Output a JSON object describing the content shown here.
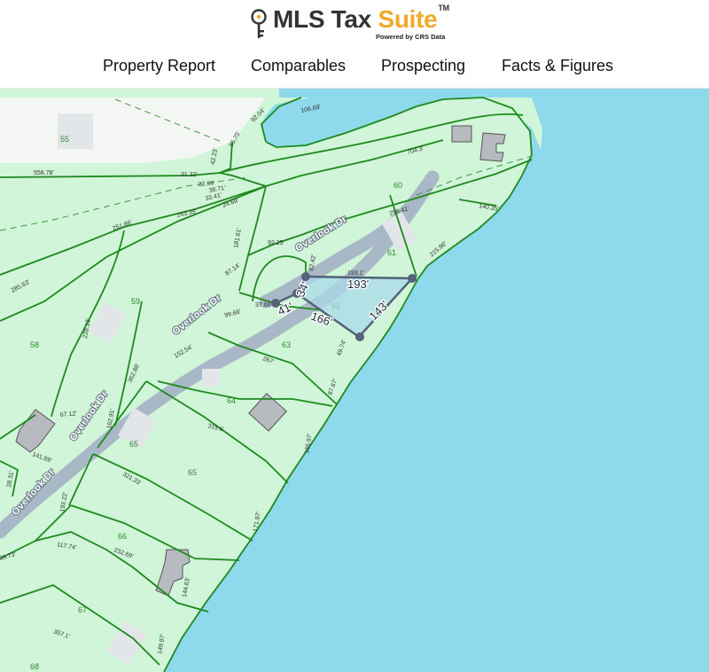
{
  "brand": {
    "name_part1": "MLS Tax ",
    "name_part2": "Suite",
    "trademark": "TM",
    "tagline": "Powered by CRS Data",
    "accent_color": "#f0a92a",
    "icon": "key-icon"
  },
  "nav": [
    {
      "label": "Property Report"
    },
    {
      "label": "Comparables"
    },
    {
      "label": "Prospecting"
    },
    {
      "label": "Facts & Figures"
    }
  ],
  "map": {
    "colors": {
      "land": "#d0f5d8",
      "water": "#8ed9ec",
      "parcel_line": "#1e8a1e",
      "road": "#a9b8c6",
      "selection": "#54637a"
    },
    "roads": [
      {
        "label": "Overlook Dr"
      },
      {
        "label": "Overlook Dr"
      },
      {
        "label": "Overlook Dr"
      },
      {
        "label": "Overlook Dr"
      }
    ],
    "lot_numbers": [
      "55",
      "60",
      "61",
      "59",
      "58",
      "62",
      "63",
      "64",
      "65",
      "65",
      "66",
      "67",
      "68"
    ],
    "dimension_labels": [
      "106.69'",
      "92.04'",
      "55.75'",
      "42.23'",
      "558.78'",
      "31.32'",
      "22.69'",
      "38.71'",
      "33.41'",
      "24.69'",
      "704.3'",
      "251.86'",
      "243.35'",
      "181.61'",
      "296.41'",
      "140.35'",
      "285.63'",
      "92.25'",
      "82.42'",
      "87.14'",
      "215.96'",
      "193.1'",
      "37.66'",
      "99.66'",
      "228.13'",
      "362.88'",
      "49.74'",
      "152.54'",
      "267'",
      "87.67'",
      "67.12'",
      "162.91'",
      "315.6'",
      "141.89'",
      "165.97'",
      "28.31'",
      "321.33'",
      "193.22'",
      "171.97'",
      "117.74'",
      "232.69'",
      "09.73'",
      "144.63'",
      "357.1'",
      "149.97'"
    ],
    "measurement": {
      "segments": [
        "193'",
        "143'",
        "166'",
        "41'",
        "34'"
      ]
    }
  }
}
